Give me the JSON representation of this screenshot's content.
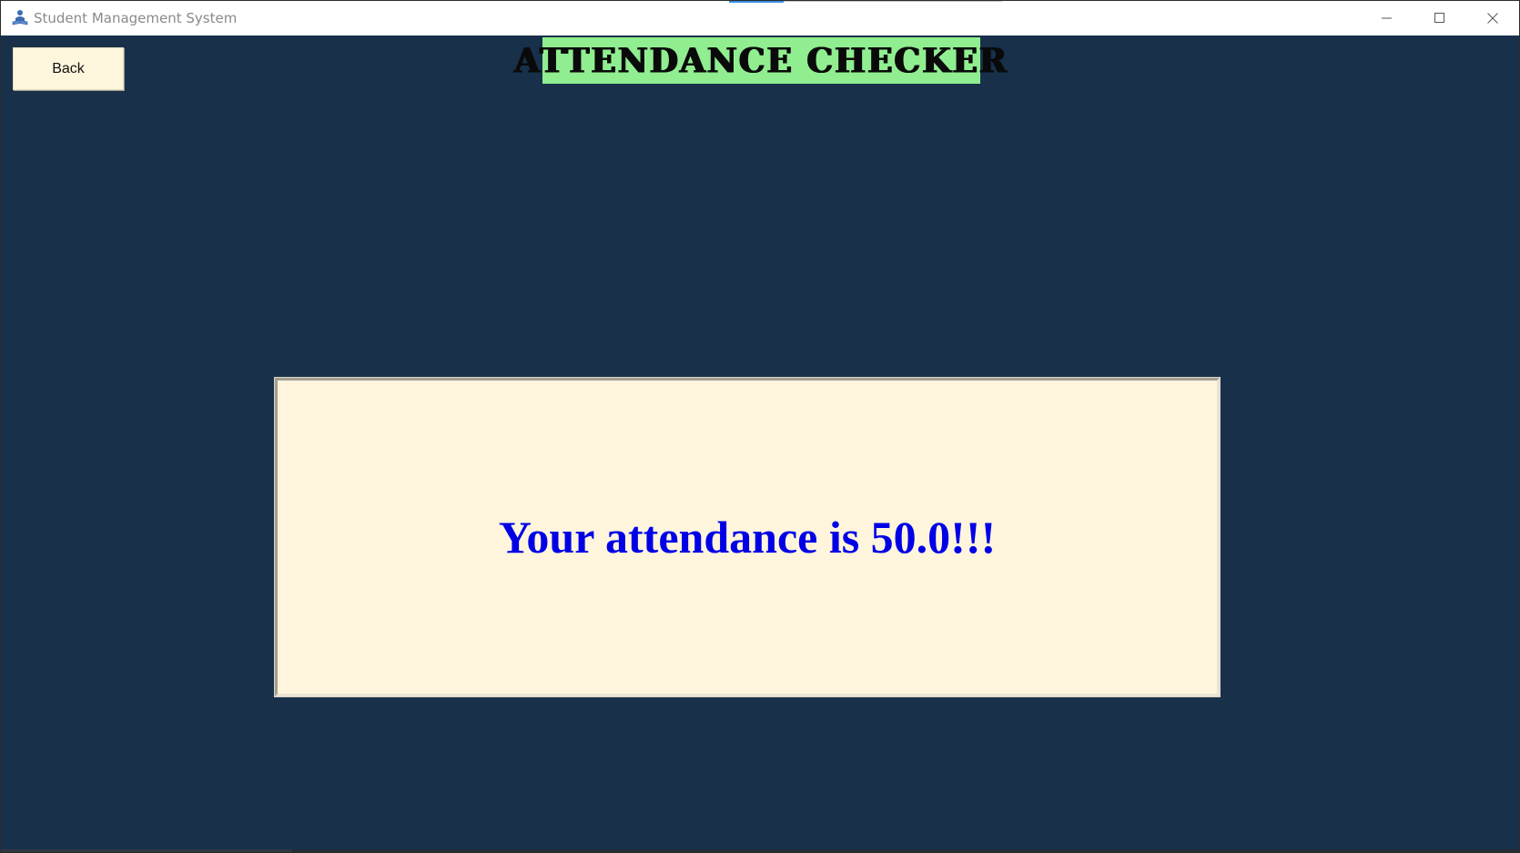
{
  "window": {
    "title": "Student Management System",
    "app_icon": "student-reading-icon",
    "controls": {
      "minimize_icon": "minimize-icon",
      "maximize_icon": "maximize-icon",
      "close_icon": "close-icon"
    }
  },
  "toolbar": {
    "back_label": "Back"
  },
  "header": {
    "title": "ATTENDANCE CHECKER"
  },
  "result": {
    "message": "Your attendance is 50.0!!!"
  },
  "colors": {
    "background": "#183049",
    "header_bg": "#90ee90",
    "panel_bg": "#fef5dc",
    "button_bg": "#fdf5dc",
    "message_text": "#0000e6"
  }
}
